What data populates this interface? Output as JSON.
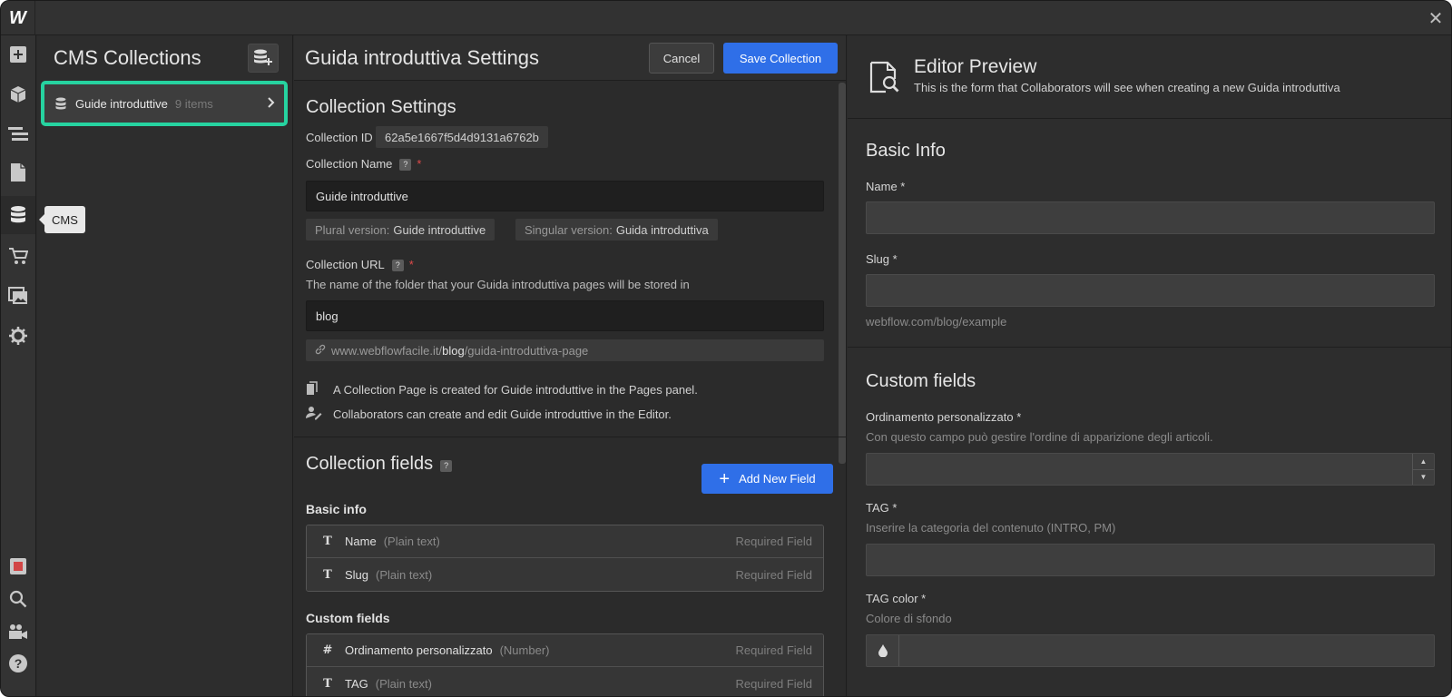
{
  "app": {
    "logo_text": "W",
    "close_glyph": "✕"
  },
  "rail": {
    "items": [
      {
        "icon": "add-icon"
      },
      {
        "icon": "cube-icon"
      },
      {
        "icon": "navigator-icon"
      },
      {
        "icon": "pages-icon"
      },
      {
        "icon": "cms-database-icon"
      },
      {
        "icon": "ecommerce-cart-icon"
      },
      {
        "icon": "assets-icon"
      },
      {
        "icon": "settings-gear-icon"
      }
    ],
    "bottom_items": [
      {
        "icon": "record-icon"
      },
      {
        "icon": "search-icon"
      },
      {
        "icon": "video-help-icon"
      },
      {
        "icon": "help-icon"
      }
    ],
    "tooltip": "CMS"
  },
  "collections": {
    "title": "CMS Collections",
    "items": [
      {
        "name": "Guide introduttive",
        "count": "9 items"
      }
    ]
  },
  "settings": {
    "title": "Guida introduttiva Settings",
    "cancel": "Cancel",
    "save": "Save Collection",
    "section_title": "Collection Settings",
    "collection_id_label": "Collection ID",
    "collection_id": "62a5e1667f5d4d9131a6762b",
    "name_label": "Collection Name",
    "name_value": "Guide introduttive",
    "plural_label": "Plural version:",
    "plural_value": "Guide introduttive",
    "singular_label": "Singular version:",
    "singular_value": "Guida introduttiva",
    "url_label": "Collection URL",
    "url_help": "The name of the folder that your Guida introduttiva pages will be stored in",
    "url_value": "blog",
    "url_prefix": "www.webflowfacile.it/",
    "url_folder": "blog",
    "url_suffix": "/guida-introduttiva-page",
    "note_pages": "A Collection Page is created for Guide introduttive in the Pages panel.",
    "note_editor": "Collaborators can create and edit Guide introduttive in the Editor.",
    "fields_title": "Collection fields",
    "add_field": "Add New Field",
    "basic_info_title": "Basic info",
    "basic_fields": [
      {
        "icon": "T",
        "name": "Name",
        "type": "(Plain text)",
        "req": "Required Field"
      },
      {
        "icon": "T",
        "name": "Slug",
        "type": "(Plain text)",
        "req": "Required Field"
      }
    ],
    "custom_title": "Custom fields",
    "custom_fields": [
      {
        "icon": "#",
        "name": "Ordinamento personalizzato",
        "type": "(Number)",
        "req": "Required Field"
      },
      {
        "icon": "T",
        "name": "TAG",
        "type": "(Plain text)",
        "req": "Required Field"
      }
    ]
  },
  "preview": {
    "title": "Editor Preview",
    "subtitle": "This is the form that Collaborators will see when creating a new Guida introduttiva",
    "basic_title": "Basic Info",
    "name_label": "Name *",
    "slug_label": "Slug *",
    "slug_hint": "webflow.com/blog/example",
    "custom_title": "Custom fields",
    "order_label": "Ordinamento personalizzato *",
    "order_hint": "Con questo campo può gestire l'ordine di apparizione degli articoli.",
    "tag_label": "TAG *",
    "tag_hint": "Inserire la categoria del contenuto (INTRO, PM)",
    "tagcolor_label": "TAG color *",
    "tagcolor_hint": "Colore di sfondo"
  }
}
